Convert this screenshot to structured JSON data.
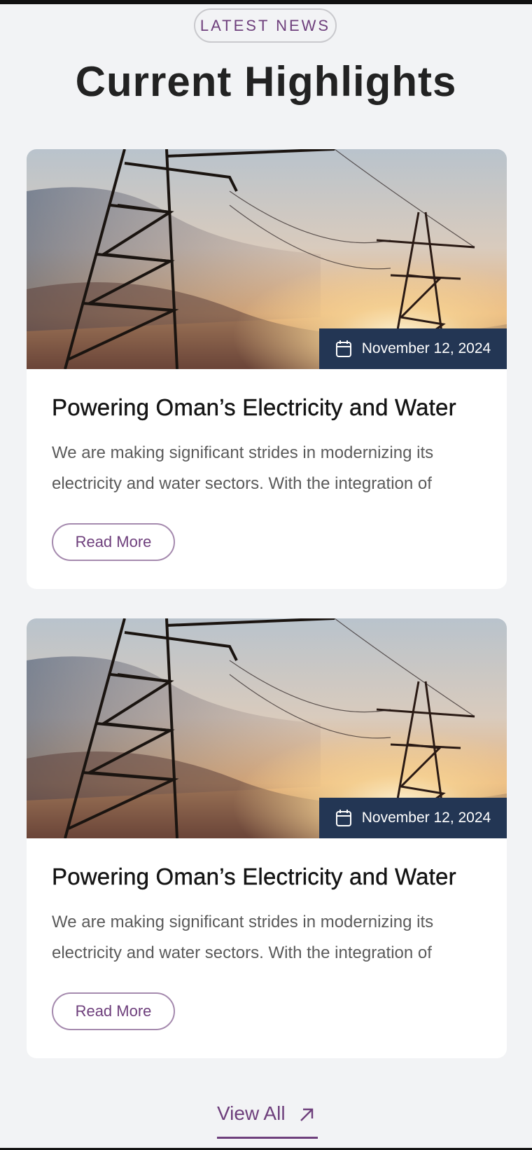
{
  "section": {
    "eyebrow": "LATEST NEWS",
    "title": "Current Highlights"
  },
  "cards": [
    {
      "date": "November 12, 2024",
      "title": "Powering Oman’s Electricity and Water",
      "excerpt": "We are making significant strides in modernizing its electricity and water sectors. With the integration of",
      "button": "Read More"
    },
    {
      "date": "November 12, 2024",
      "title": "Powering Oman’s Electricity and Water",
      "excerpt": "We are making significant strides in modernizing its electricity and water sectors. With the integration of",
      "button": "Read More"
    }
  ],
  "footer": {
    "view_all": "View All"
  },
  "icons": {
    "date": "calendar-icon",
    "view_all": "arrow-up-right-icon"
  },
  "colors": {
    "accent": "#6e3f7c",
    "badge": "#233654",
    "background": "#f2f3f5"
  }
}
